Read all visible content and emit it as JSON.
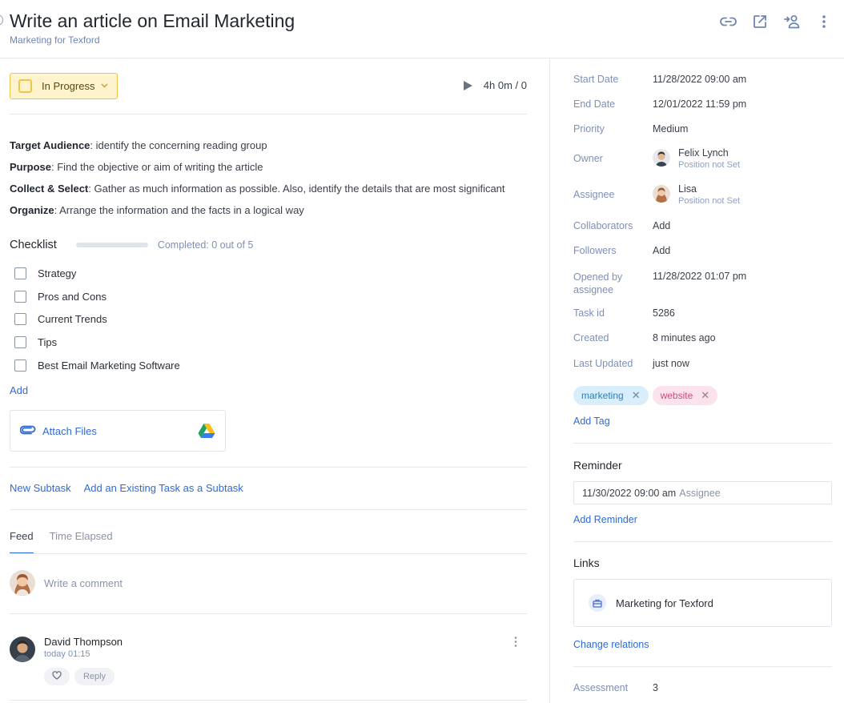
{
  "header": {
    "title": "Write an article on Email Marketing",
    "subtitle": "Marketing for Texford",
    "icons": [
      "link-icon",
      "open-external-icon",
      "assign-user-icon",
      "more-vertical-icon"
    ]
  },
  "status": {
    "label": "In Progress",
    "color": "#f0c54a"
  },
  "timer": {
    "value": "4h 0m / 0"
  },
  "description": [
    {
      "key": "Target Audience",
      "text": ": identify the concerning reading group"
    },
    {
      "key": "Purpose",
      "text": ": Find the objective or aim of writing the article"
    },
    {
      "key": "Collect & Select",
      "text": ": Gather as much information as possible. Also, identify the details that are most significant"
    },
    {
      "key": "Organize",
      "text": ": Arrange the information and the facts in a logical way"
    }
  ],
  "checklist": {
    "title": "Checklist",
    "completed_text": "Completed: 0 out of 5",
    "progress": 0,
    "items": [
      "Strategy",
      "Pros and Cons",
      "Current Trends",
      "Tips",
      "Best Email Marketing Software"
    ],
    "add_label": "Add"
  },
  "attach": {
    "label": "Attach Files"
  },
  "subtasks": {
    "new_label": "New Subtask",
    "existing_label": "Add an Existing Task as a Subtask"
  },
  "tabs": [
    {
      "label": "Feed",
      "active": true
    },
    {
      "label": "Time Elapsed",
      "active": false
    }
  ],
  "comment": {
    "placeholder": "Write a comment"
  },
  "feed": [
    {
      "name": "David Thompson",
      "time": "today 01:15",
      "reply_label": "Reply"
    }
  ],
  "properties": {
    "start_date": {
      "label": "Start Date",
      "value": "11/28/2022 09:00 am"
    },
    "end_date": {
      "label": "End Date",
      "value": "12/01/2022 11:59 pm"
    },
    "priority": {
      "label": "Priority",
      "value": "Medium"
    },
    "owner": {
      "label": "Owner",
      "name": "Felix Lynch",
      "position": "Position not Set"
    },
    "assignee": {
      "label": "Assignee",
      "name": "Lisa",
      "position": "Position not Set"
    },
    "collaborators": {
      "label": "Collaborators",
      "value": "Add"
    },
    "followers": {
      "label": "Followers",
      "value": "Add"
    },
    "opened_by": {
      "label": "Opened by assignee",
      "value": "11/28/2022 01:07 pm"
    },
    "task_id": {
      "label": "Task id",
      "value": "5286"
    },
    "created": {
      "label": "Created",
      "value": "8 minutes ago"
    },
    "last_updated": {
      "label": "Last Updated",
      "value": "just now"
    }
  },
  "tags": [
    {
      "label": "marketing",
      "color": "#2a7fbf"
    },
    {
      "label": "website",
      "color": "#d24b7a"
    }
  ],
  "add_tag_label": "Add Tag",
  "reminder": {
    "title": "Reminder",
    "date": "11/30/2022 09:00 am",
    "target": "Assignee",
    "add_label": "Add Reminder"
  },
  "links": {
    "title": "Links",
    "items": [
      "Marketing for Texford"
    ],
    "change_label": "Change relations"
  },
  "assessment": {
    "label": "Assessment",
    "value": "3"
  }
}
